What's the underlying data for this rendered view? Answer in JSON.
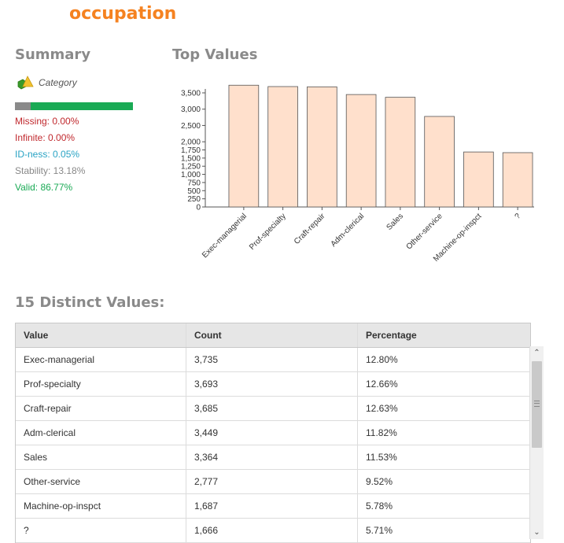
{
  "title": "occupation",
  "summary": {
    "heading": "Summary",
    "type_label": "Category",
    "missing": "Missing: 0.00%",
    "infinite": "Infinite: 0.00%",
    "idness": "ID-ness: 0.05%",
    "stability": "Stability: 13.18%",
    "valid": "Valid: 86.77%",
    "missing_fraction": 0.1323
  },
  "top_values": {
    "heading": "Top Values"
  },
  "chart_data": {
    "type": "bar",
    "categories": [
      "Exec-managerial",
      "Prof-specialty",
      "Craft-repair",
      "Adm-clerical",
      "Sales",
      "Other-service",
      "Machine-op-inspct",
      "?"
    ],
    "values": [
      3735,
      3693,
      3685,
      3449,
      3364,
      2777,
      1687,
      1666
    ],
    "title": "",
    "xlabel": "",
    "ylabel": "",
    "ylim": [
      0,
      3500
    ],
    "yticks": [
      "0",
      "250",
      "500",
      "750",
      "1,000",
      "1,250",
      "1,500",
      "1,750",
      "2,000",
      "2,500",
      "3,000",
      "3,500"
    ],
    "bar_color": "#ffe0cc",
    "bar_stroke": "#555555"
  },
  "distinct": {
    "heading": "15 Distinct Values:",
    "columns": [
      "Value",
      "Count",
      "Percentage"
    ],
    "rows": [
      [
        "Exec-managerial",
        "3,735",
        "12.80%"
      ],
      [
        "Prof-specialty",
        "3,693",
        "12.66%"
      ],
      [
        "Craft-repair",
        "3,685",
        "12.63%"
      ],
      [
        "Adm-clerical",
        "3,449",
        "11.82%"
      ],
      [
        "Sales",
        "3,364",
        "11.53%"
      ],
      [
        "Other-service",
        "2,777",
        "9.52%"
      ],
      [
        "Machine-op-inspct",
        "1,687",
        "5.78%"
      ],
      [
        "?",
        "1,666",
        "5.71%"
      ]
    ]
  },
  "colors": {
    "accent": "#f58220",
    "missing": "#c0282d",
    "valid": "#1aaa55",
    "idness": "#29a3c4"
  }
}
